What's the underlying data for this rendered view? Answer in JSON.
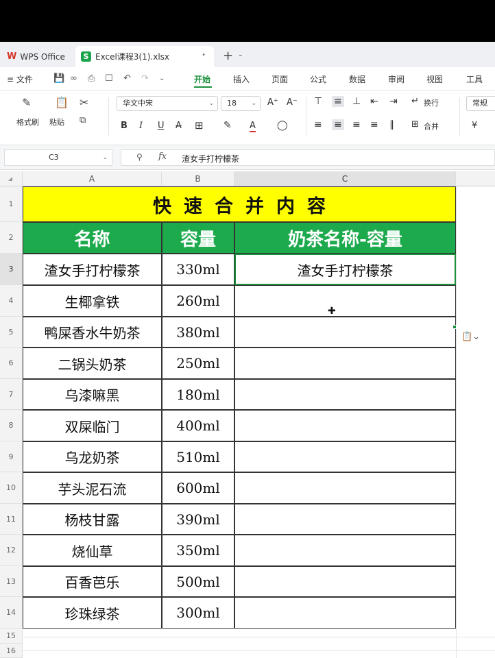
{
  "tabs": {
    "wps_label": "WPS Office",
    "file_label": "Excel课程3(1).xlsx",
    "close_glyph": "•",
    "add_glyph": "+"
  },
  "menu": {
    "file_label": "文件",
    "tabs": [
      "开始",
      "插入",
      "页面",
      "公式",
      "数据",
      "审阅",
      "视图",
      "工具"
    ],
    "active_tab": "开始"
  },
  "ribbon": {
    "format_painter": "格式刷",
    "paste": "粘贴",
    "font_name": "华文中宋",
    "font_size": "18",
    "wrap_text": "换行",
    "merge": "合并",
    "number_format": "常规",
    "currency": "¥"
  },
  "formula_bar": {
    "cell_ref": "C3",
    "fx_label": "fx",
    "content": "渣女手打柠檬茶"
  },
  "grid": {
    "columns": [
      "A",
      "B",
      "C"
    ],
    "row_numbers": [
      "1",
      "2",
      "3",
      "4",
      "5",
      "6",
      "7",
      "8",
      "9",
      "10",
      "11",
      "12",
      "13",
      "14",
      "15",
      "16"
    ],
    "title": "快速合并内容",
    "headers": [
      "名称",
      "容量",
      "奶茶名称-容量"
    ],
    "rows": [
      {
        "name": "渣女手打柠檬茶",
        "volume": "330ml",
        "combined": "渣女手打柠檬茶"
      },
      {
        "name": "生椰拿铁",
        "volume": "260ml",
        "combined": ""
      },
      {
        "name": "鸭屎香水牛奶茶",
        "volume": "380ml",
        "combined": ""
      },
      {
        "name": "二锅头奶茶",
        "volume": "250ml",
        "combined": ""
      },
      {
        "name": "乌漆嘛黑",
        "volume": "180ml",
        "combined": ""
      },
      {
        "name": "双屎临门",
        "volume": "400ml",
        "combined": ""
      },
      {
        "name": "乌龙奶茶",
        "volume": "510ml",
        "combined": ""
      },
      {
        "name": "芋头泥石流",
        "volume": "600ml",
        "combined": ""
      },
      {
        "name": "杨枝甘露",
        "volume": "390ml",
        "combined": ""
      },
      {
        "name": "烧仙草",
        "volume": "350ml",
        "combined": ""
      },
      {
        "name": "百香芭乐",
        "volume": "500ml",
        "combined": ""
      },
      {
        "name": "珍珠绿茶",
        "volume": "300ml",
        "combined": ""
      }
    ],
    "selected_cell": "C3"
  },
  "colors": {
    "title_bg": "#ffff00",
    "header_bg": "#1daa4d",
    "accent": "#1a8f3c"
  }
}
